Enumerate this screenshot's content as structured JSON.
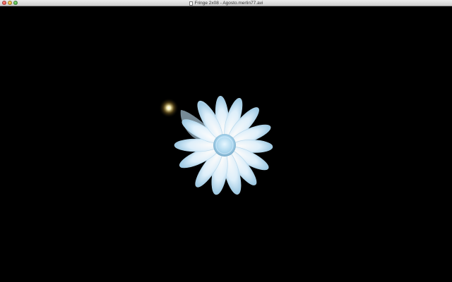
{
  "window": {
    "title": "Fringe 2x08 - Agosto.merlin77.avi"
  },
  "controls": {
    "close": "close-button",
    "minimize": "minimize-button",
    "zoom": "zoom-button"
  },
  "video": {
    "background_color": "#000000",
    "flower_color": "#dff3ff",
    "glow_color": "#fff3b0"
  }
}
